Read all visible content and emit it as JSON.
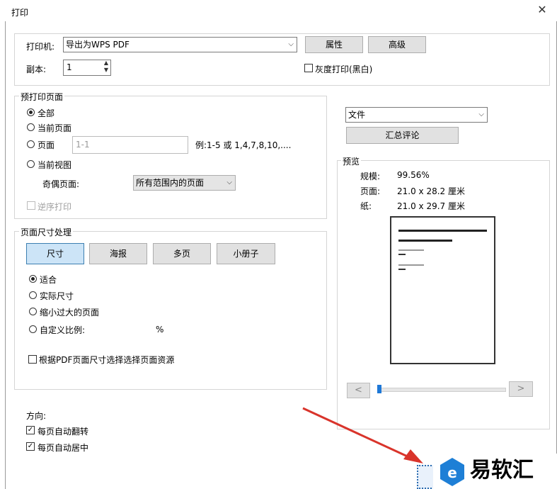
{
  "window": {
    "title": "打印",
    "close": "✕"
  },
  "printer": {
    "label": "打印机:",
    "selected": "导出为WPS PDF",
    "properties": "属性",
    "advanced": "高级",
    "copies_label": "副本:",
    "copies_value": "1",
    "grayscale": "灰度打印(黑白)"
  },
  "range": {
    "legend": "预打印页面",
    "all": "全部",
    "current": "当前页面",
    "pages": "页面",
    "pages_placeholder": "1-1",
    "pages_example": "例:1-5 或 1,4,7,8,10,....",
    "current_view": "当前视图",
    "odd_even_label": "奇偶页面:",
    "odd_even_value": "所有范围内的页面",
    "reverse": "逆序打印"
  },
  "sizing": {
    "legend": "页面尺寸处理",
    "tabs": [
      "尺寸",
      "海报",
      "多页",
      "小册子"
    ],
    "fit": "适合",
    "actual": "实际尺寸",
    "shrink": "缩小过大的页面",
    "custom": "自定义比例:",
    "percent": "%",
    "choose_source": "根据PDF页面尺寸选择选择页面资源"
  },
  "orientation": {
    "label": "方向:",
    "auto_rotate": "每页自动翻转",
    "auto_center": "每页自动居中"
  },
  "document": {
    "select": "文件",
    "summarize": "汇总评论"
  },
  "preview": {
    "legend": "预览",
    "scale_label": "规模:",
    "scale_value": "99.56%",
    "page_label": "页面:",
    "page_value": "21.0 x 28.2 厘米",
    "paper_label": "纸:",
    "paper_value": "21.0 x 29.7 厘米",
    "prev": "<",
    "next": ">"
  },
  "watermark": {
    "text": "易软汇"
  },
  "colors": {
    "accent": "#1e78d7",
    "arrow": "#d9342b"
  }
}
